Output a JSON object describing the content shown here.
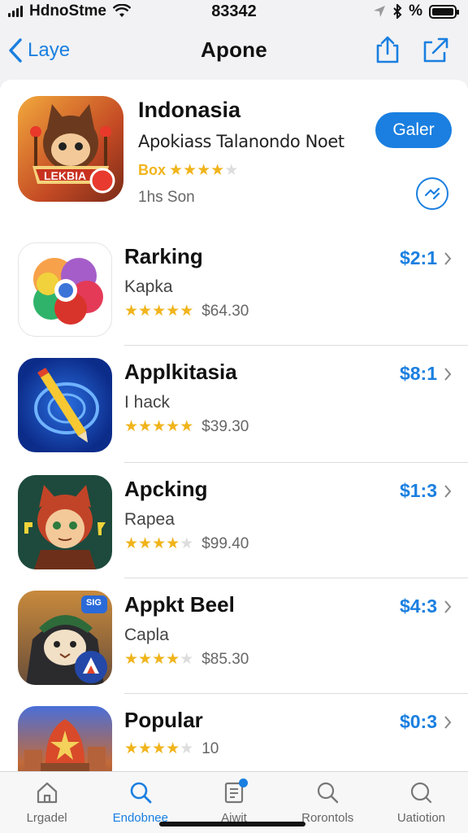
{
  "status_bar": {
    "carrier": "HdnoStme",
    "time": "83342",
    "battery_label": "%"
  },
  "nav": {
    "back_label": "Laye",
    "title": "Apone"
  },
  "featured": {
    "name": "Indonasia",
    "subtitle": "Apokiass Talanondo Noet",
    "rating_label": "Box",
    "rating": 3.5,
    "size_text": "1hs Son",
    "get_label": "Galer",
    "icon_banner": "LEKBIA"
  },
  "apps": [
    {
      "name": "Rarking",
      "subtitle": "Kapka",
      "rating": 5,
      "rating_text": "$64.30",
      "price": "$2:1"
    },
    {
      "name": "Applkitasia",
      "subtitle": "I hack",
      "rating": 4.5,
      "rating_text": "$39.30",
      "price": "$8:1"
    },
    {
      "name": "Apcking",
      "subtitle": "Rapea",
      "rating": 3.5,
      "rating_text": "$99.40",
      "price": "$1:3"
    },
    {
      "name": "Appkt Beel",
      "subtitle": "Capla",
      "rating": 4,
      "rating_text": "$85.30",
      "price": "$4:3",
      "icon_badge": "SIG"
    },
    {
      "name": "Popular",
      "subtitle": "",
      "rating": 3.5,
      "rating_text": "10",
      "price": "$0:3"
    }
  ],
  "tabs": [
    {
      "label": "Lrgadel",
      "icon": "home-icon",
      "active": false
    },
    {
      "label": "Endobnee",
      "icon": "search-icon",
      "active": true
    },
    {
      "label": "Aiwit",
      "icon": "document-icon",
      "active": false,
      "badge": true
    },
    {
      "label": "Rorontols",
      "icon": "search-icon",
      "active": false
    },
    {
      "label": "Uatiotion",
      "icon": "profile-icon",
      "active": false
    }
  ],
  "colors": {
    "accent": "#1a7fe0",
    "star": "#f0b41c",
    "star_empty": "#dddddd"
  }
}
